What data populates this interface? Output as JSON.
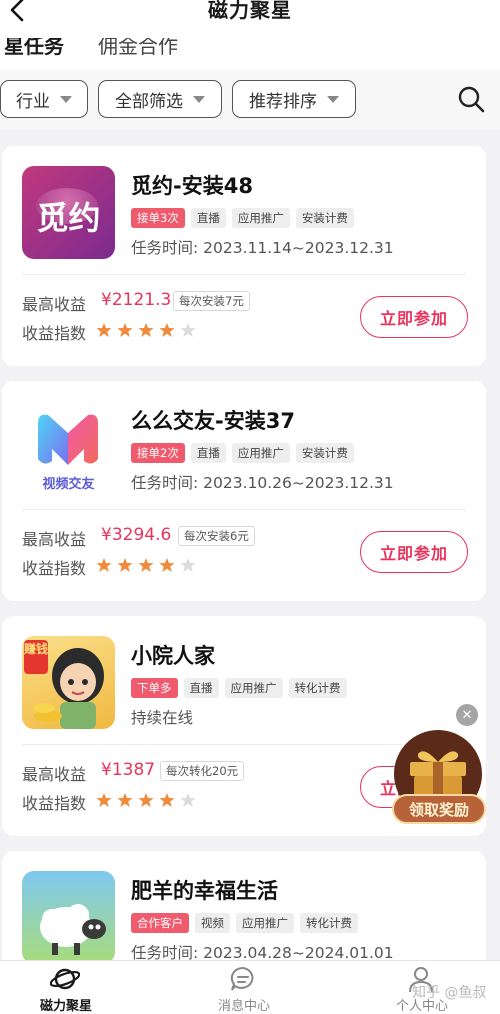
{
  "header": {
    "title": "磁力聚星"
  },
  "tabs": [
    {
      "label": "星任务"
    },
    {
      "label": "佣金合作"
    }
  ],
  "filters": [
    {
      "label": "行业"
    },
    {
      "label": "全部筛选"
    },
    {
      "label": "推荐排序"
    }
  ],
  "labels": {
    "income": "最高收益",
    "index": "收益指数",
    "join": "立即参加"
  },
  "tasks": [
    {
      "icon_text": "觅约",
      "name": "觅约-安装48",
      "tags": [
        "接单3次",
        "直播",
        "应用推广",
        "安装计费"
      ],
      "time": "任务时间: 2023.11.14~2023.12.31",
      "income": "¥2121.3",
      "per": "每次安装7元",
      "rating": 4
    },
    {
      "icon_text": "视频交友",
      "name": "么么交友-安装37",
      "tags": [
        "接单2次",
        "直播",
        "应用推广",
        "安装计费"
      ],
      "time": "任务时间: 2023.10.26~2023.12.31",
      "income": "¥3294.6",
      "per": "每次安装6元",
      "rating": 4
    },
    {
      "icon_text": "赚钱",
      "name": "小院人家",
      "tags": [
        "下单多",
        "直播",
        "应用推广",
        "转化计费"
      ],
      "time": "持续在线",
      "income": "¥1387",
      "per": "每次转化20元",
      "rating": 4
    },
    {
      "name": "肥羊的幸福生活",
      "tags": [
        "合作客户",
        "视频",
        "应用推广",
        "转化计费"
      ],
      "time": "任务时间: 2023.04.28~2024.01.01"
    }
  ],
  "gift": {
    "label": "领取奖励"
  },
  "bottom_nav": [
    {
      "label": "磁力聚星"
    },
    {
      "label": "消息中心"
    },
    {
      "label": "个人中心"
    }
  ],
  "watermark": "知乎 @鱼叔",
  "colors": {
    "accent": "#e8335c",
    "star": "#f08a3c",
    "hot_tag": "#f05a6d"
  }
}
